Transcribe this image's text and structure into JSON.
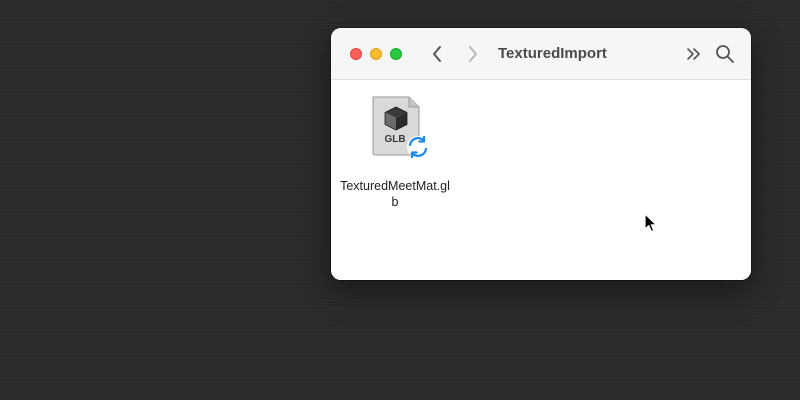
{
  "window": {
    "title": "TexturedImport"
  },
  "files": [
    {
      "name": "TexturedMeetMat.glb",
      "icon_label": "GLB",
      "icon": "glb-3d-file-icon",
      "badge_icon": "sync-icon"
    }
  ],
  "toolbar": {
    "back_icon": "chevron-left-icon",
    "forward_icon": "chevron-right-icon",
    "more_icon": "double-chevron-right-icon",
    "search_icon": "search-icon"
  },
  "colors": {
    "desktop": "#2b2b2b",
    "close": "#fe5f57",
    "minimize": "#febc2e",
    "zoom": "#28c840",
    "sync_badge": "#1a8ae6"
  }
}
